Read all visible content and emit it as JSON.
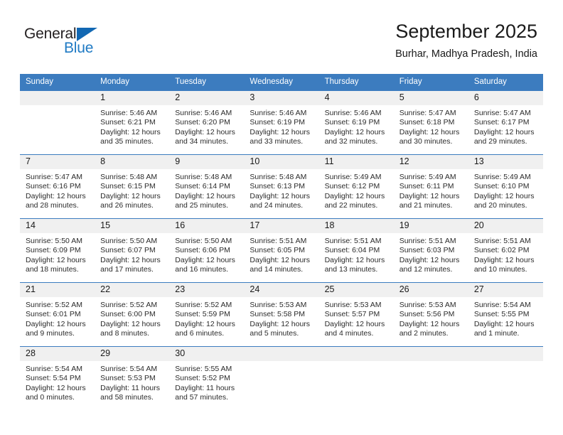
{
  "logo": {
    "text_primary": "General",
    "text_secondary": "Blue",
    "triangle_color": "#1268b3",
    "secondary_color": "#1f7ac4"
  },
  "header": {
    "title": "September 2025",
    "subtitle": "Burhar, Madhya Pradesh, India"
  },
  "theme": {
    "header_blue": "#3c7cbf",
    "daynum_background": "#f0f0f0",
    "text_color": "#1a1a1a"
  },
  "calendar": {
    "weekdays": [
      "Sunday",
      "Monday",
      "Tuesday",
      "Wednesday",
      "Thursday",
      "Friday",
      "Saturday"
    ],
    "weeks": [
      [
        {
          "day": "",
          "sunrise": "",
          "sunset": "",
          "daylight_line1": "",
          "daylight_line2": ""
        },
        {
          "day": "1",
          "sunrise": "Sunrise: 5:46 AM",
          "sunset": "Sunset: 6:21 PM",
          "daylight_line1": "Daylight: 12 hours",
          "daylight_line2": "and 35 minutes."
        },
        {
          "day": "2",
          "sunrise": "Sunrise: 5:46 AM",
          "sunset": "Sunset: 6:20 PM",
          "daylight_line1": "Daylight: 12 hours",
          "daylight_line2": "and 34 minutes."
        },
        {
          "day": "3",
          "sunrise": "Sunrise: 5:46 AM",
          "sunset": "Sunset: 6:19 PM",
          "daylight_line1": "Daylight: 12 hours",
          "daylight_line2": "and 33 minutes."
        },
        {
          "day": "4",
          "sunrise": "Sunrise: 5:46 AM",
          "sunset": "Sunset: 6:19 PM",
          "daylight_line1": "Daylight: 12 hours",
          "daylight_line2": "and 32 minutes."
        },
        {
          "day": "5",
          "sunrise": "Sunrise: 5:47 AM",
          "sunset": "Sunset: 6:18 PM",
          "daylight_line1": "Daylight: 12 hours",
          "daylight_line2": "and 30 minutes."
        },
        {
          "day": "6",
          "sunrise": "Sunrise: 5:47 AM",
          "sunset": "Sunset: 6:17 PM",
          "daylight_line1": "Daylight: 12 hours",
          "daylight_line2": "and 29 minutes."
        }
      ],
      [
        {
          "day": "7",
          "sunrise": "Sunrise: 5:47 AM",
          "sunset": "Sunset: 6:16 PM",
          "daylight_line1": "Daylight: 12 hours",
          "daylight_line2": "and 28 minutes."
        },
        {
          "day": "8",
          "sunrise": "Sunrise: 5:48 AM",
          "sunset": "Sunset: 6:15 PM",
          "daylight_line1": "Daylight: 12 hours",
          "daylight_line2": "and 26 minutes."
        },
        {
          "day": "9",
          "sunrise": "Sunrise: 5:48 AM",
          "sunset": "Sunset: 6:14 PM",
          "daylight_line1": "Daylight: 12 hours",
          "daylight_line2": "and 25 minutes."
        },
        {
          "day": "10",
          "sunrise": "Sunrise: 5:48 AM",
          "sunset": "Sunset: 6:13 PM",
          "daylight_line1": "Daylight: 12 hours",
          "daylight_line2": "and 24 minutes."
        },
        {
          "day": "11",
          "sunrise": "Sunrise: 5:49 AM",
          "sunset": "Sunset: 6:12 PM",
          "daylight_line1": "Daylight: 12 hours",
          "daylight_line2": "and 22 minutes."
        },
        {
          "day": "12",
          "sunrise": "Sunrise: 5:49 AM",
          "sunset": "Sunset: 6:11 PM",
          "daylight_line1": "Daylight: 12 hours",
          "daylight_line2": "and 21 minutes."
        },
        {
          "day": "13",
          "sunrise": "Sunrise: 5:49 AM",
          "sunset": "Sunset: 6:10 PM",
          "daylight_line1": "Daylight: 12 hours",
          "daylight_line2": "and 20 minutes."
        }
      ],
      [
        {
          "day": "14",
          "sunrise": "Sunrise: 5:50 AM",
          "sunset": "Sunset: 6:09 PM",
          "daylight_line1": "Daylight: 12 hours",
          "daylight_line2": "and 18 minutes."
        },
        {
          "day": "15",
          "sunrise": "Sunrise: 5:50 AM",
          "sunset": "Sunset: 6:07 PM",
          "daylight_line1": "Daylight: 12 hours",
          "daylight_line2": "and 17 minutes."
        },
        {
          "day": "16",
          "sunrise": "Sunrise: 5:50 AM",
          "sunset": "Sunset: 6:06 PM",
          "daylight_line1": "Daylight: 12 hours",
          "daylight_line2": "and 16 minutes."
        },
        {
          "day": "17",
          "sunrise": "Sunrise: 5:51 AM",
          "sunset": "Sunset: 6:05 PM",
          "daylight_line1": "Daylight: 12 hours",
          "daylight_line2": "and 14 minutes."
        },
        {
          "day": "18",
          "sunrise": "Sunrise: 5:51 AM",
          "sunset": "Sunset: 6:04 PM",
          "daylight_line1": "Daylight: 12 hours",
          "daylight_line2": "and 13 minutes."
        },
        {
          "day": "19",
          "sunrise": "Sunrise: 5:51 AM",
          "sunset": "Sunset: 6:03 PM",
          "daylight_line1": "Daylight: 12 hours",
          "daylight_line2": "and 12 minutes."
        },
        {
          "day": "20",
          "sunrise": "Sunrise: 5:51 AM",
          "sunset": "Sunset: 6:02 PM",
          "daylight_line1": "Daylight: 12 hours",
          "daylight_line2": "and 10 minutes."
        }
      ],
      [
        {
          "day": "21",
          "sunrise": "Sunrise: 5:52 AM",
          "sunset": "Sunset: 6:01 PM",
          "daylight_line1": "Daylight: 12 hours",
          "daylight_line2": "and 9 minutes."
        },
        {
          "day": "22",
          "sunrise": "Sunrise: 5:52 AM",
          "sunset": "Sunset: 6:00 PM",
          "daylight_line1": "Daylight: 12 hours",
          "daylight_line2": "and 8 minutes."
        },
        {
          "day": "23",
          "sunrise": "Sunrise: 5:52 AM",
          "sunset": "Sunset: 5:59 PM",
          "daylight_line1": "Daylight: 12 hours",
          "daylight_line2": "and 6 minutes."
        },
        {
          "day": "24",
          "sunrise": "Sunrise: 5:53 AM",
          "sunset": "Sunset: 5:58 PM",
          "daylight_line1": "Daylight: 12 hours",
          "daylight_line2": "and 5 minutes."
        },
        {
          "day": "25",
          "sunrise": "Sunrise: 5:53 AM",
          "sunset": "Sunset: 5:57 PM",
          "daylight_line1": "Daylight: 12 hours",
          "daylight_line2": "and 4 minutes."
        },
        {
          "day": "26",
          "sunrise": "Sunrise: 5:53 AM",
          "sunset": "Sunset: 5:56 PM",
          "daylight_line1": "Daylight: 12 hours",
          "daylight_line2": "and 2 minutes."
        },
        {
          "day": "27",
          "sunrise": "Sunrise: 5:54 AM",
          "sunset": "Sunset: 5:55 PM",
          "daylight_line1": "Daylight: 12 hours",
          "daylight_line2": "and 1 minute."
        }
      ],
      [
        {
          "day": "28",
          "sunrise": "Sunrise: 5:54 AM",
          "sunset": "Sunset: 5:54 PM",
          "daylight_line1": "Daylight: 12 hours",
          "daylight_line2": "and 0 minutes."
        },
        {
          "day": "29",
          "sunrise": "Sunrise: 5:54 AM",
          "sunset": "Sunset: 5:53 PM",
          "daylight_line1": "Daylight: 11 hours",
          "daylight_line2": "and 58 minutes."
        },
        {
          "day": "30",
          "sunrise": "Sunrise: 5:55 AM",
          "sunset": "Sunset: 5:52 PM",
          "daylight_line1": "Daylight: 11 hours",
          "daylight_line2": "and 57 minutes."
        },
        {
          "day": "",
          "sunrise": "",
          "sunset": "",
          "daylight_line1": "",
          "daylight_line2": ""
        },
        {
          "day": "",
          "sunrise": "",
          "sunset": "",
          "daylight_line1": "",
          "daylight_line2": ""
        },
        {
          "day": "",
          "sunrise": "",
          "sunset": "",
          "daylight_line1": "",
          "daylight_line2": ""
        },
        {
          "day": "",
          "sunrise": "",
          "sunset": "",
          "daylight_line1": "",
          "daylight_line2": ""
        }
      ]
    ]
  }
}
